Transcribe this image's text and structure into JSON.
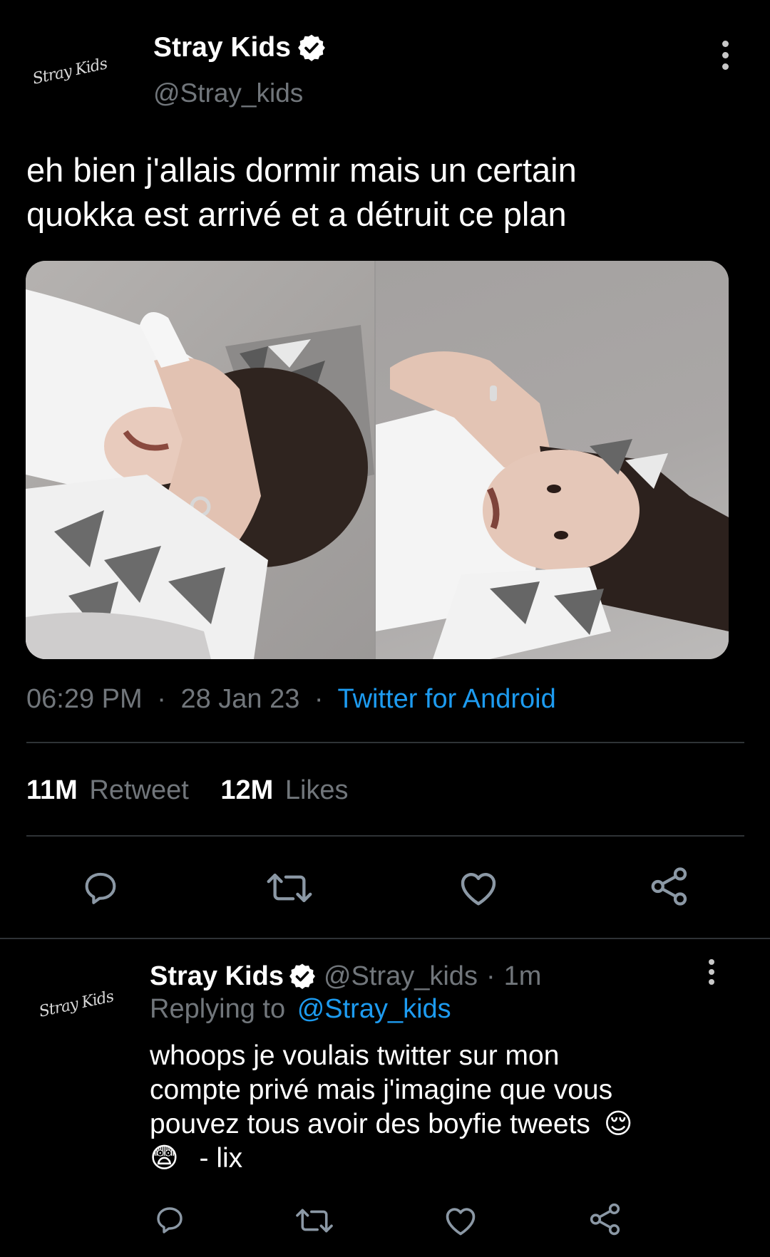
{
  "tweet": {
    "author_name": "Stray Kids",
    "author_handle": "@Stray_kids",
    "avatar_logo_text": "Stray Kids",
    "text_line1": "eh bien j'allais dormir mais un certain",
    "text_line2": "quokka est arrivé et a détruit ce plan",
    "time": "06:29 PM",
    "date": "28 Jan 23",
    "source": "Twitter for Android",
    "sep": "·",
    "retweet_count": "11M",
    "retweet_label": "Retweet",
    "likes_count": "12M",
    "likes_label": "Likes"
  },
  "reply": {
    "author_name": "Stray Kids",
    "author_handle": "@Stray_kids",
    "sep": "·",
    "time_ago": "1m",
    "replying_prefix": "Replying to",
    "replying_handle": "@Stray_kids",
    "text_line1": "whoops je voulais twitter sur mon",
    "text_line2": "compte privé mais j'imagine que vous",
    "text_line3": "pouvez tous avoir des boyfie tweets",
    "emoji1": "😌",
    "emoji2": "😨",
    "text_line4_suffix": "- lix"
  },
  "colors": {
    "background": "#000000",
    "text": "#e7e9ea",
    "muted": "#71767b",
    "accent": "#1d9bf0",
    "divider": "#2f3336"
  },
  "icons": [
    "verified-badge-icon",
    "more-options-icon",
    "reply-icon",
    "retweet-icon",
    "like-icon",
    "share-icon"
  ]
}
